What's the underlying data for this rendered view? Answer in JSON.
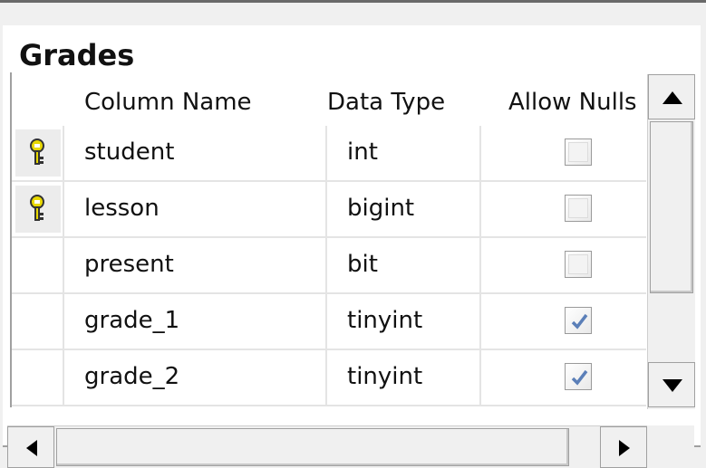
{
  "table": {
    "title": "Grades"
  },
  "columns": {
    "name": "Column Name",
    "type": "Data Type",
    "nulls": "Allow Nulls"
  },
  "rows": [
    {
      "name": "student",
      "type": "int",
      "primary_key": true,
      "allow_nulls": false
    },
    {
      "name": "lesson",
      "type": "bigint",
      "primary_key": true,
      "allow_nulls": false
    },
    {
      "name": "present",
      "type": "bit",
      "primary_key": false,
      "allow_nulls": false
    },
    {
      "name": "grade_1",
      "type": "tinyint",
      "primary_key": false,
      "allow_nulls": true
    },
    {
      "name": "grade_2",
      "type": "tinyint",
      "primary_key": false,
      "allow_nulls": true
    }
  ],
  "icons": {
    "key": "primary-key-icon",
    "check": "checkmark-icon"
  },
  "colors": {
    "key": "#e8d800",
    "check": "#5b7fb8",
    "border": "#a0a0a0"
  }
}
